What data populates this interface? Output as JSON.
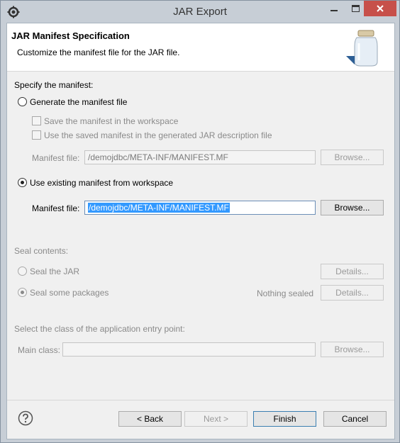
{
  "window": {
    "title": "JAR Export",
    "accent": "#c7504a"
  },
  "banner": {
    "title": "JAR Manifest Specification",
    "description": "Customize the manifest file for the JAR file."
  },
  "manifest": {
    "section_label": "Specify the manifest:",
    "generate_option": {
      "label": "Generate the manifest file",
      "selected": false
    },
    "save_in_workspace": {
      "label": "Save the manifest in the workspace",
      "checked": false
    },
    "use_saved_in_description": {
      "label": "Use the saved manifest in the generated JAR description file",
      "checked": false
    },
    "generated_file": {
      "label": "Manifest file:",
      "value": "/demojdbc/META-INF/MANIFEST.MF",
      "browse": "Browse..."
    },
    "existing_option": {
      "label": "Use existing manifest from workspace",
      "selected": true
    },
    "existing_file": {
      "label": "Manifest file:",
      "value": "/demojdbc/META-INF/MANIFEST.MF",
      "browse": "Browse..."
    }
  },
  "seal": {
    "section_label": "Seal contents:",
    "seal_jar": {
      "label": "Seal the JAR",
      "selected": false,
      "details": "Details..."
    },
    "seal_some": {
      "label": "Seal some packages",
      "selected": true,
      "status": "Nothing sealed",
      "details": "Details..."
    }
  },
  "entry_point": {
    "section_label": "Select the class of the application entry point:",
    "main_class": {
      "label": "Main class:",
      "value": "",
      "browse": "Browse..."
    }
  },
  "footer": {
    "help_icon": "help-icon",
    "back": "< Back",
    "next": "Next >",
    "finish": "Finish",
    "cancel": "Cancel"
  }
}
